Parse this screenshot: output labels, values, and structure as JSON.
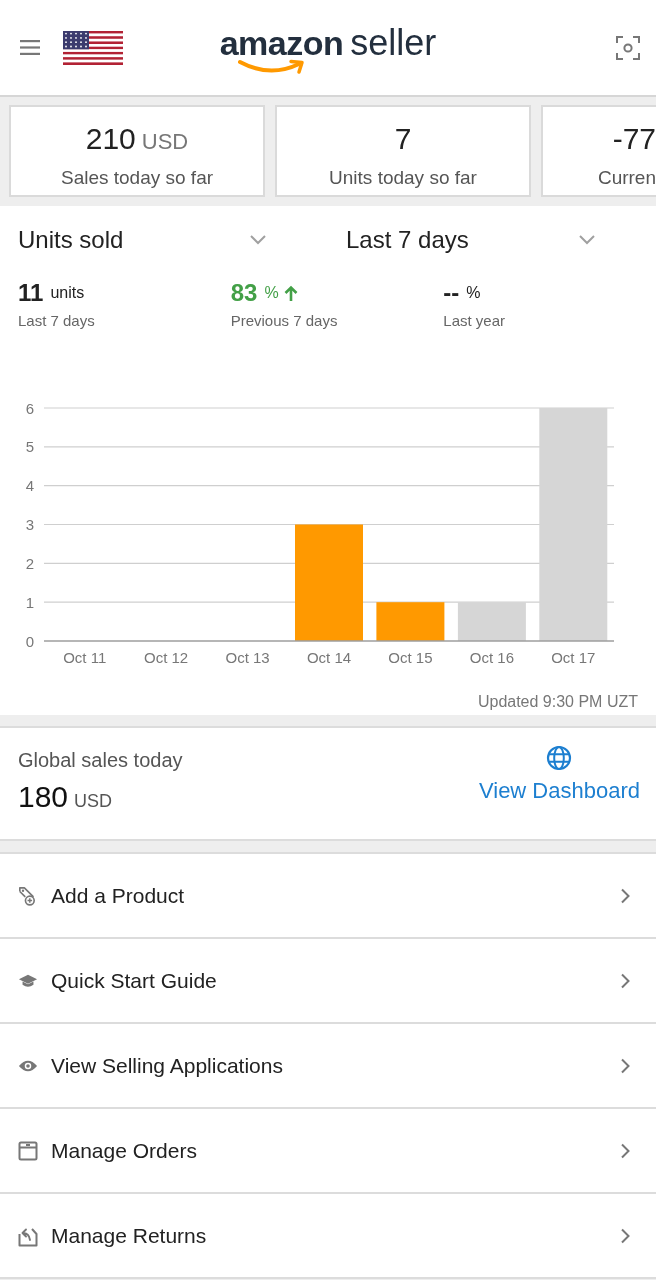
{
  "header": {
    "logo": {
      "brand": "amazon",
      "suffix": "seller"
    }
  },
  "kpis": [
    {
      "value": "210",
      "unit": "USD",
      "label": "Sales today so far"
    },
    {
      "value": "7",
      "label": "Units today so far"
    },
    {
      "value": "-77",
      "label": "Curren"
    }
  ],
  "selectors": [
    {
      "label": "Units sold"
    },
    {
      "label": "Last 7 days"
    }
  ],
  "stats": [
    {
      "value": "11",
      "unit": "units",
      "caption": "Last 7 days",
      "trend_up": false
    },
    {
      "value": "83",
      "unit": "%",
      "caption": "Previous 7 days",
      "trend_up": true
    },
    {
      "value": "--",
      "unit": "%",
      "caption": "Last year",
      "trend_up": false
    }
  ],
  "chart": {
    "chart_data": {
      "type": "bar",
      "categories": [
        "Oct 11",
        "Oct 12",
        "Oct 13",
        "Oct 14",
        "Oct 15",
        "Oct 16",
        "Oct 17"
      ],
      "series": [
        {
          "color": "#ff9900",
          "values": [
            0,
            0,
            0,
            3,
            1,
            null,
            null
          ]
        },
        {
          "color": "#d6d6d6",
          "values": [
            null,
            null,
            null,
            null,
            null,
            1,
            6
          ]
        }
      ],
      "ylim": [
        0,
        6
      ],
      "yticks": [
        0,
        1,
        2,
        3,
        4,
        5,
        6
      ],
      "stacked": true,
      "grid": true
    },
    "updated": "Updated 9:30 PM UZT"
  },
  "global_sales": {
    "title": "Global sales today",
    "value": "180",
    "unit": "USD",
    "link": "View Dashboard"
  },
  "menu": [
    {
      "label": "Add a Product"
    },
    {
      "label": "Quick Start Guide"
    },
    {
      "label": "View Selling Applications"
    },
    {
      "label": "Manage Orders"
    },
    {
      "label": "Manage Returns"
    }
  ]
}
